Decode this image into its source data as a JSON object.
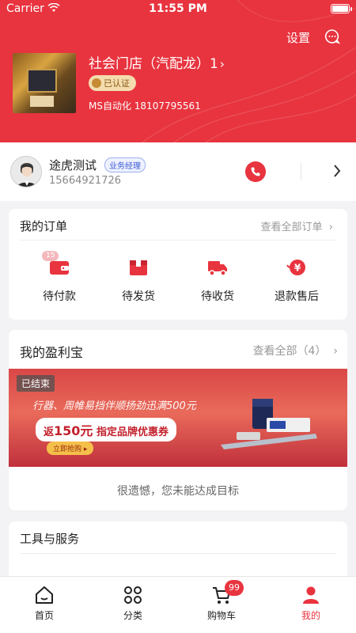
{
  "status_bar": {
    "carrier": "Carrier",
    "time": "11:55 PM"
  },
  "header": {
    "settings_label": "设置",
    "shop_name": "社会门店（汽配龙）1",
    "verified_label": "已认证",
    "contact": "MS自动化  18107795561"
  },
  "manager": {
    "name": "途虎测试",
    "role": "业务经理",
    "phone": "15664921726"
  },
  "orders": {
    "title": "我的订单",
    "view_all": "查看全部订单",
    "items": [
      {
        "label": "待付款",
        "count": "15",
        "icon": "wallet-icon"
      },
      {
        "label": "待发货",
        "icon": "box-icon"
      },
      {
        "label": "待收货",
        "icon": "truck-icon"
      },
      {
        "label": "退款售后",
        "icon": "refund-icon"
      }
    ]
  },
  "profit": {
    "title": "我的盈利宝",
    "view_all": "查看全部（4）",
    "banner": {
      "status": "已结束",
      "line1": "行器、周帷易挡伴顺扬劲迅满500元",
      "line2_prefix": "返",
      "line2_amount": "150元",
      "line2_suffix": "指定品牌优惠券",
      "button": "立即抢购 ▸"
    },
    "message": "很遗憾，您未能达成目标"
  },
  "tools": {
    "title": "工具与服务"
  },
  "tabbar": {
    "items": [
      {
        "label": "首页",
        "icon": "home-icon"
      },
      {
        "label": "分类",
        "icon": "category-icon"
      },
      {
        "label": "购物车",
        "icon": "cart-icon",
        "badge": "99"
      },
      {
        "label": "我的",
        "icon": "profile-icon",
        "active": true
      }
    ]
  },
  "colors": {
    "brand_red": "#e8343f",
    "background": "#f3f3f5"
  }
}
